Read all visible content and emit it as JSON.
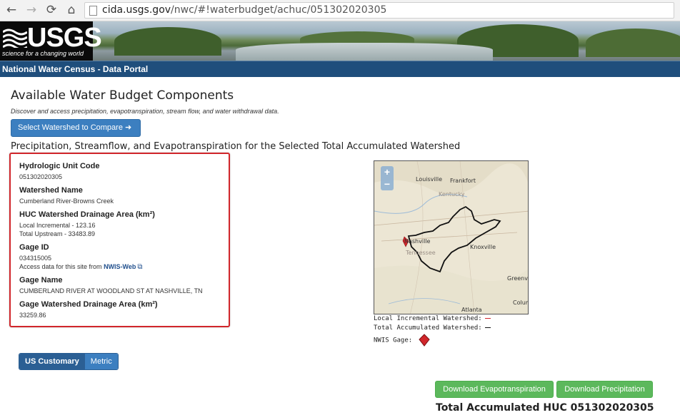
{
  "browser": {
    "url_host": "cida.usgs.gov",
    "url_path": "/nwc/#!waterbudget/achuc/051302020305"
  },
  "banner": {
    "logo_text": "USGS",
    "logo_tagline": "science for a changing world"
  },
  "portal": {
    "title": "National Water Census - Data Portal"
  },
  "page": {
    "title": "Available Water Budget Components",
    "subtitle": "Discover and access precipitation, evapotranspiration, stream flow, and water withdrawal data.",
    "compare_button": "Select Watershed to Compare ➜",
    "section_heading": "Precipitation, Streamflow, and Evapotranspiration for the Selected Total Accumulated Watershed"
  },
  "info": {
    "huc_label": "Hydrologic Unit Code",
    "huc_value": "051302020305",
    "name_label": "Watershed Name",
    "name_value": "Cumberland River-Browns Creek",
    "area_label": "HUC Watershed Drainage Area (km²)",
    "area_local": "Local Incremental - 123.16",
    "area_upstream": "Total Upstream - 33483.89",
    "gage_id_label": "Gage ID",
    "gage_id_value": "034315005",
    "access_text": "Access data for this site from",
    "access_link": "NWIS-Web",
    "gage_name_label": "Gage Name",
    "gage_name_value": "CUMBERLAND RIVER AT WOODLAND ST AT NASHVILLE, TN",
    "gage_area_label": "Gage Watershed Drainage Area (km²)",
    "gage_area_value": "33259.86"
  },
  "map": {
    "zoom_in": "+",
    "zoom_out": "−",
    "labels": {
      "louisville": "Louisville",
      "frankfort": "Frankfort",
      "kentucky": "Kentucky",
      "nashville": "Nashville",
      "tennessee": "Tennessee",
      "knoxville": "Knoxville",
      "greenville": "Greenvi",
      "columbia": "Colum",
      "atlanta": "Atlanta"
    }
  },
  "legend": {
    "local": "Local Incremental Watershed:",
    "total": "Total Accumulated Watershed:",
    "gage": "NWIS Gage:"
  },
  "units": {
    "us": "US Customary",
    "metric": "Metric"
  },
  "downloads": {
    "evapo": "Download Evapotranspiration",
    "precip": "Download Precipitation"
  },
  "bottom_title": "Total Accumulated HUC 051302020305"
}
